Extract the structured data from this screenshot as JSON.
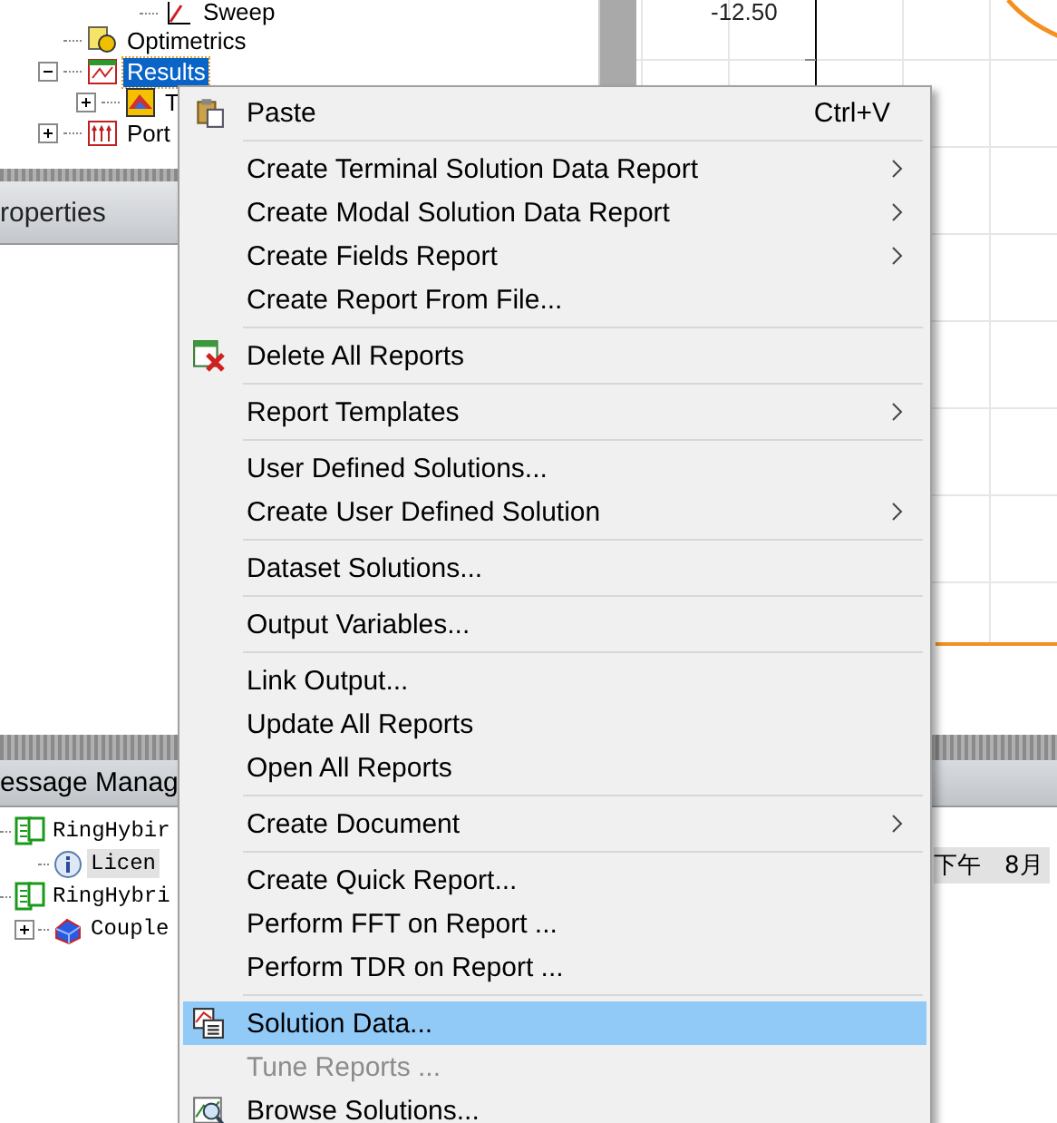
{
  "project_tree": {
    "continued_children": [
      {
        "label": "Sweep",
        "selected": false
      }
    ],
    "items": [
      {
        "label": "Optimetrics",
        "selected": false
      },
      {
        "label": "Results",
        "kind": "expanded",
        "selected": true,
        "children": [
          {
            "label": "T",
            "kind": "collapsed",
            "selected": false
          }
        ]
      },
      {
        "label": "Port",
        "kind": "collapsed",
        "selected": false
      }
    ]
  },
  "properties_panel": {
    "title": "roperties"
  },
  "plot": {
    "axis_label": "-12.50"
  },
  "message_manager": {
    "title": "essage Manag",
    "items": [
      {
        "label": "RingHybir",
        "selected": false,
        "children": [
          {
            "label": "Licen",
            "selected": true
          }
        ]
      },
      {
        "label": "RingHybri",
        "selected": false,
        "children": [
          {
            "label": "Couple",
            "kind": "collapsed",
            "selected": false
          }
        ]
      }
    ],
    "timestamp": "下午　8月"
  },
  "context_menu": {
    "items": [
      {
        "kind": "item",
        "label": "Paste",
        "shortcut": "Ctrl+V",
        "submenu": false,
        "selected": false,
        "disabled": false
      },
      {
        "kind": "separator"
      },
      {
        "kind": "item",
        "label": "Create Terminal Solution Data Report",
        "submenu": true,
        "selected": false,
        "disabled": false
      },
      {
        "kind": "item",
        "label": "Create Modal Solution Data Report",
        "submenu": true,
        "selected": false,
        "disabled": false
      },
      {
        "kind": "item",
        "label": "Create Fields Report",
        "submenu": true,
        "selected": false,
        "disabled": false
      },
      {
        "kind": "item",
        "label": "Create Report From File...",
        "submenu": false,
        "selected": false,
        "disabled": false
      },
      {
        "kind": "separator"
      },
      {
        "kind": "item",
        "label": "Delete All Reports",
        "submenu": false,
        "selected": false,
        "disabled": false
      },
      {
        "kind": "separator"
      },
      {
        "kind": "item",
        "label": "Report Templates",
        "submenu": true,
        "selected": false,
        "disabled": false
      },
      {
        "kind": "separator"
      },
      {
        "kind": "item",
        "label": "User Defined Solutions...",
        "submenu": false,
        "selected": false,
        "disabled": false
      },
      {
        "kind": "item",
        "label": "Create User Defined Solution",
        "submenu": true,
        "selected": false,
        "disabled": false
      },
      {
        "kind": "separator"
      },
      {
        "kind": "item",
        "label": "Dataset Solutions...",
        "submenu": false,
        "selected": false,
        "disabled": false
      },
      {
        "kind": "separator"
      },
      {
        "kind": "item",
        "label": "Output Variables...",
        "submenu": false,
        "selected": false,
        "disabled": false
      },
      {
        "kind": "separator"
      },
      {
        "kind": "item",
        "label": "Link Output...",
        "submenu": false,
        "selected": false,
        "disabled": false
      },
      {
        "kind": "item",
        "label": "Update All Reports",
        "submenu": false,
        "selected": false,
        "disabled": false
      },
      {
        "kind": "item",
        "label": "Open All Reports",
        "submenu": false,
        "selected": false,
        "disabled": false
      },
      {
        "kind": "separator"
      },
      {
        "kind": "item",
        "label": "Create Document",
        "submenu": true,
        "selected": false,
        "disabled": false
      },
      {
        "kind": "separator"
      },
      {
        "kind": "item",
        "label": "Create Quick Report...",
        "submenu": false,
        "selected": false,
        "disabled": false
      },
      {
        "kind": "item",
        "label": "Perform FFT on Report ...",
        "submenu": false,
        "selected": false,
        "disabled": false
      },
      {
        "kind": "item",
        "label": "Perform TDR on Report ...",
        "submenu": false,
        "selected": false,
        "disabled": false
      },
      {
        "kind": "separator"
      },
      {
        "kind": "item",
        "label": "Solution Data...",
        "submenu": false,
        "selected": true,
        "disabled": false
      },
      {
        "kind": "item",
        "label": "Tune Reports ...",
        "submenu": false,
        "selected": false,
        "disabled": true
      },
      {
        "kind": "item",
        "label": "Browse Solutions...",
        "submenu": false,
        "selected": false,
        "disabled": false
      }
    ]
  }
}
